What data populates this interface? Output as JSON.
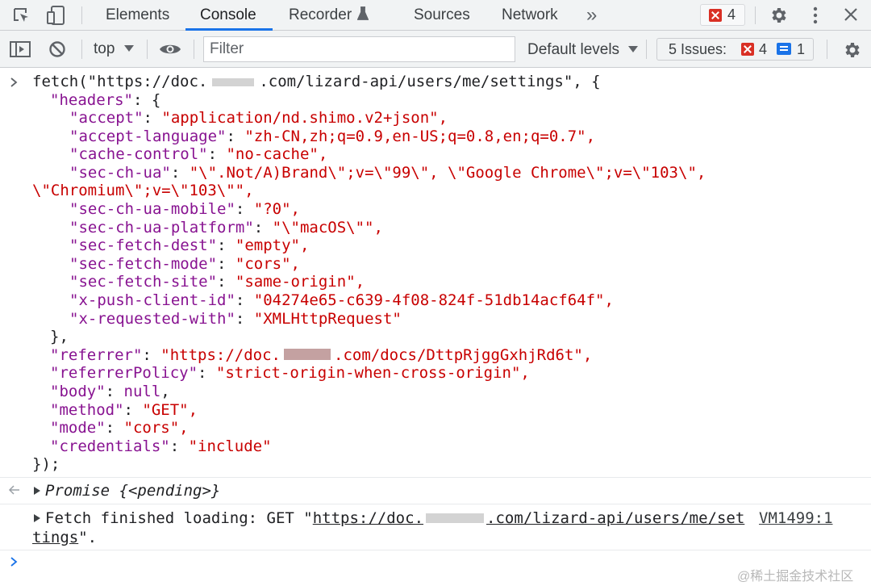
{
  "toolbar": {
    "tabs": [
      {
        "label": "Elements"
      },
      {
        "label": "Console"
      },
      {
        "label": "Recorder"
      },
      {
        "label": "Sources"
      },
      {
        "label": "Network"
      }
    ],
    "more_label": "»",
    "error_count": "4"
  },
  "console_toolbar": {
    "context": "top",
    "filter_placeholder": "Filter",
    "levels": "Default levels",
    "issues_label": "5 Issues:",
    "issues_errors": "4",
    "issues_info": "1"
  },
  "console": {
    "input_lines": [
      "fetch(\"https://doc.",
      ".com/lizard-api/users/me/settings\", {"
    ],
    "headers_key": "\"headers\"",
    "headers": [
      {
        "key": "\"accept\"",
        "value": "\"application/nd.shimo.v2+json\","
      },
      {
        "key": "\"accept-language\"",
        "value": "\"zh-CN,zh;q=0.9,en-US;q=0.8,en;q=0.7\","
      },
      {
        "key": "\"cache-control\"",
        "value": "\"no-cache\","
      },
      {
        "key": "\"sec-ch-ua\"",
        "value": "\"\\\".Not/A)Brand\\\";v=\\\"99\\\", \\\"Google Chrome\\\";v=\\\"103\\\","
      },
      {
        "key": "",
        "value": "\\\"Chromium\\\";v=\\\"103\\\"\","
      },
      {
        "key": "\"sec-ch-ua-mobile\"",
        "value": "\"?0\","
      },
      {
        "key": "\"sec-ch-ua-platform\"",
        "value": "\"\\\"macOS\\\"\","
      },
      {
        "key": "\"sec-fetch-dest\"",
        "value": "\"empty\","
      },
      {
        "key": "\"sec-fetch-mode\"",
        "value": "\"cors\","
      },
      {
        "key": "\"sec-fetch-site\"",
        "value": "\"same-origin\","
      },
      {
        "key": "\"x-push-client-id\"",
        "value": "\"04274e65-c639-4f08-824f-51db14acf64f\","
      },
      {
        "key": "\"x-requested-with\"",
        "value": "\"XMLHttpRequest\""
      }
    ],
    "close_headers": "},",
    "referrer_key": "\"referrer\"",
    "referrer_value_a": "\"https://doc.",
    "referrer_value_b": ".com/docs/DttpRjggGxhjRd6t\",",
    "policy_key": "\"referrerPolicy\"",
    "policy_value": "\"strict-origin-when-cross-origin\",",
    "body_key": "\"body\"",
    "body_value": "null",
    "method_key": "\"method\"",
    "method_value": "\"GET\",",
    "mode_key": "\"mode\"",
    "mode_value": "\"cors\",",
    "credentials_key": "\"credentials\"",
    "credentials_value": "\"include\"",
    "close_call": "});",
    "promise_label": "Promise",
    "promise_state": "{<pending>}",
    "fetch_log_prefix": "Fetch finished loading: GET \"",
    "fetch_log_url_a": "https://doc.",
    "fetch_log_url_b": ".com/lizard-api/users/me/set",
    "fetch_log_url_c": "tings",
    "fetch_log_suffix": "\".",
    "fetch_log_source": "VM1499:1"
  },
  "watermark": "@稀土掘金技术社区",
  "colors": {
    "key": "#881391",
    "string": "#c80000",
    "accent": "#1a73e8",
    "error": "#d93025"
  }
}
